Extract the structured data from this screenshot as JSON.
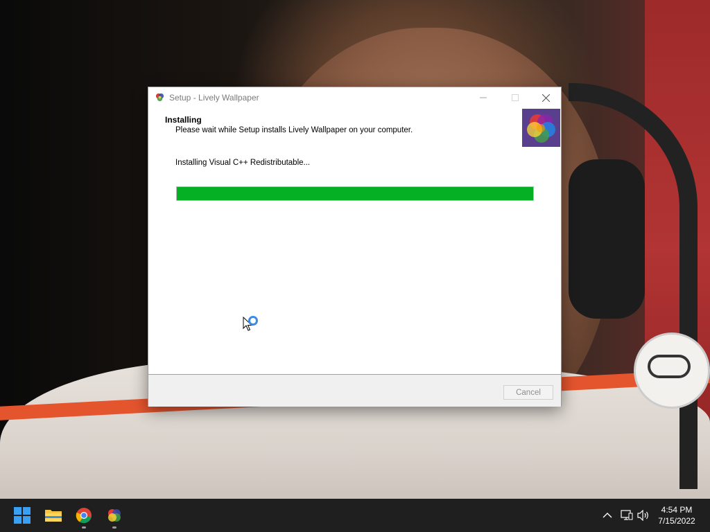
{
  "window": {
    "title": "Setup - Lively Wallpaper",
    "header_title": "Installing",
    "header_subtitle": "Please wait while Setup installs Lively Wallpaper on your computer.",
    "status_text": "Installing Visual C++ Redistributable...",
    "progress_fraction": 1.0,
    "cancel_label": "Cancel",
    "colors": {
      "progress": "#06b025",
      "footer": "#f0f0f0"
    }
  },
  "taskbar": {
    "pinned_icons": [
      "start-icon",
      "file-explorer-icon",
      "chrome-icon",
      "lively-wallpaper-icon"
    ],
    "tray_icons": [
      "chevron-up-icon",
      "network-icon",
      "volume-icon"
    ],
    "time": "4:54 PM",
    "date": "7/15/2022"
  }
}
